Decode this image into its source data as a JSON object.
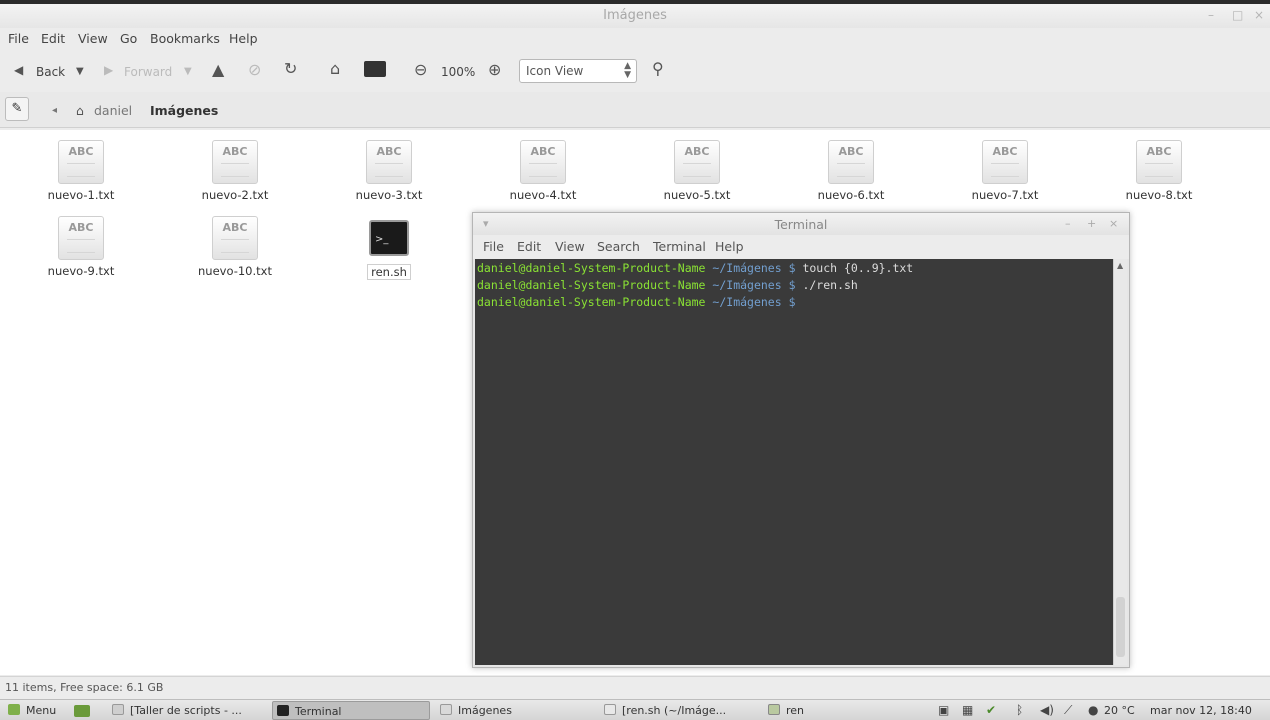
{
  "window": {
    "title": "Imágenes"
  },
  "menu": [
    "File",
    "Edit",
    "View",
    "Go",
    "Bookmarks",
    "Help"
  ],
  "toolbar": {
    "back": "Back",
    "forward": "Forward",
    "zoom": "100%",
    "view_mode": "Icon View"
  },
  "path": {
    "home": "daniel",
    "current": "Imágenes"
  },
  "files": [
    {
      "name": "nuevo-1.txt",
      "icon_text": "ABC"
    },
    {
      "name": "nuevo-2.txt",
      "icon_text": "ABC"
    },
    {
      "name": "nuevo-3.txt",
      "icon_text": "ABC"
    },
    {
      "name": "nuevo-4.txt",
      "icon_text": "ABC"
    },
    {
      "name": "nuevo-5.txt",
      "icon_text": "ABC"
    },
    {
      "name": "nuevo-6.txt",
      "icon_text": "ABC"
    },
    {
      "name": "nuevo-7.txt",
      "icon_text": "ABC"
    },
    {
      "name": "nuevo-8.txt",
      "icon_text": "ABC"
    },
    {
      "name": "nuevo-9.txt",
      "icon_text": "ABC"
    },
    {
      "name": "nuevo-10.txt",
      "icon_text": "ABC"
    },
    {
      "name": "ren.sh",
      "icon_text": ">_"
    }
  ],
  "terminal": {
    "title": "Terminal",
    "menu": [
      "File",
      "Edit",
      "View",
      "Search",
      "Terminal",
      "Help"
    ],
    "lines": [
      {
        "user": "daniel@daniel-System-Product-Name",
        "dir": "~/Imágenes $",
        "cmd": "touch {0..9}.txt"
      },
      {
        "user": "daniel@daniel-System-Product-Name",
        "dir": "~/Imágenes $",
        "cmd": "./ren.sh"
      },
      {
        "user": "daniel@daniel-System-Product-Name",
        "dir": "~/Imágenes $",
        "cmd": ""
      }
    ]
  },
  "status": {
    "text": "11 items, Free space: 6.1 GB"
  },
  "taskbar": {
    "menu_label": "Menu",
    "tasks": [
      "[Taller de scripts - ...",
      "Terminal",
      "Imágenes",
      "[ren.sh (~/Imáge...",
      "ren"
    ],
    "weather": "20 °C",
    "clock": "mar nov 12, 18:40"
  },
  "colors": {
    "prompt_user": "#8ae234",
    "prompt_dir": "#729fcf",
    "terminal_bg": "#3a3a3a"
  }
}
